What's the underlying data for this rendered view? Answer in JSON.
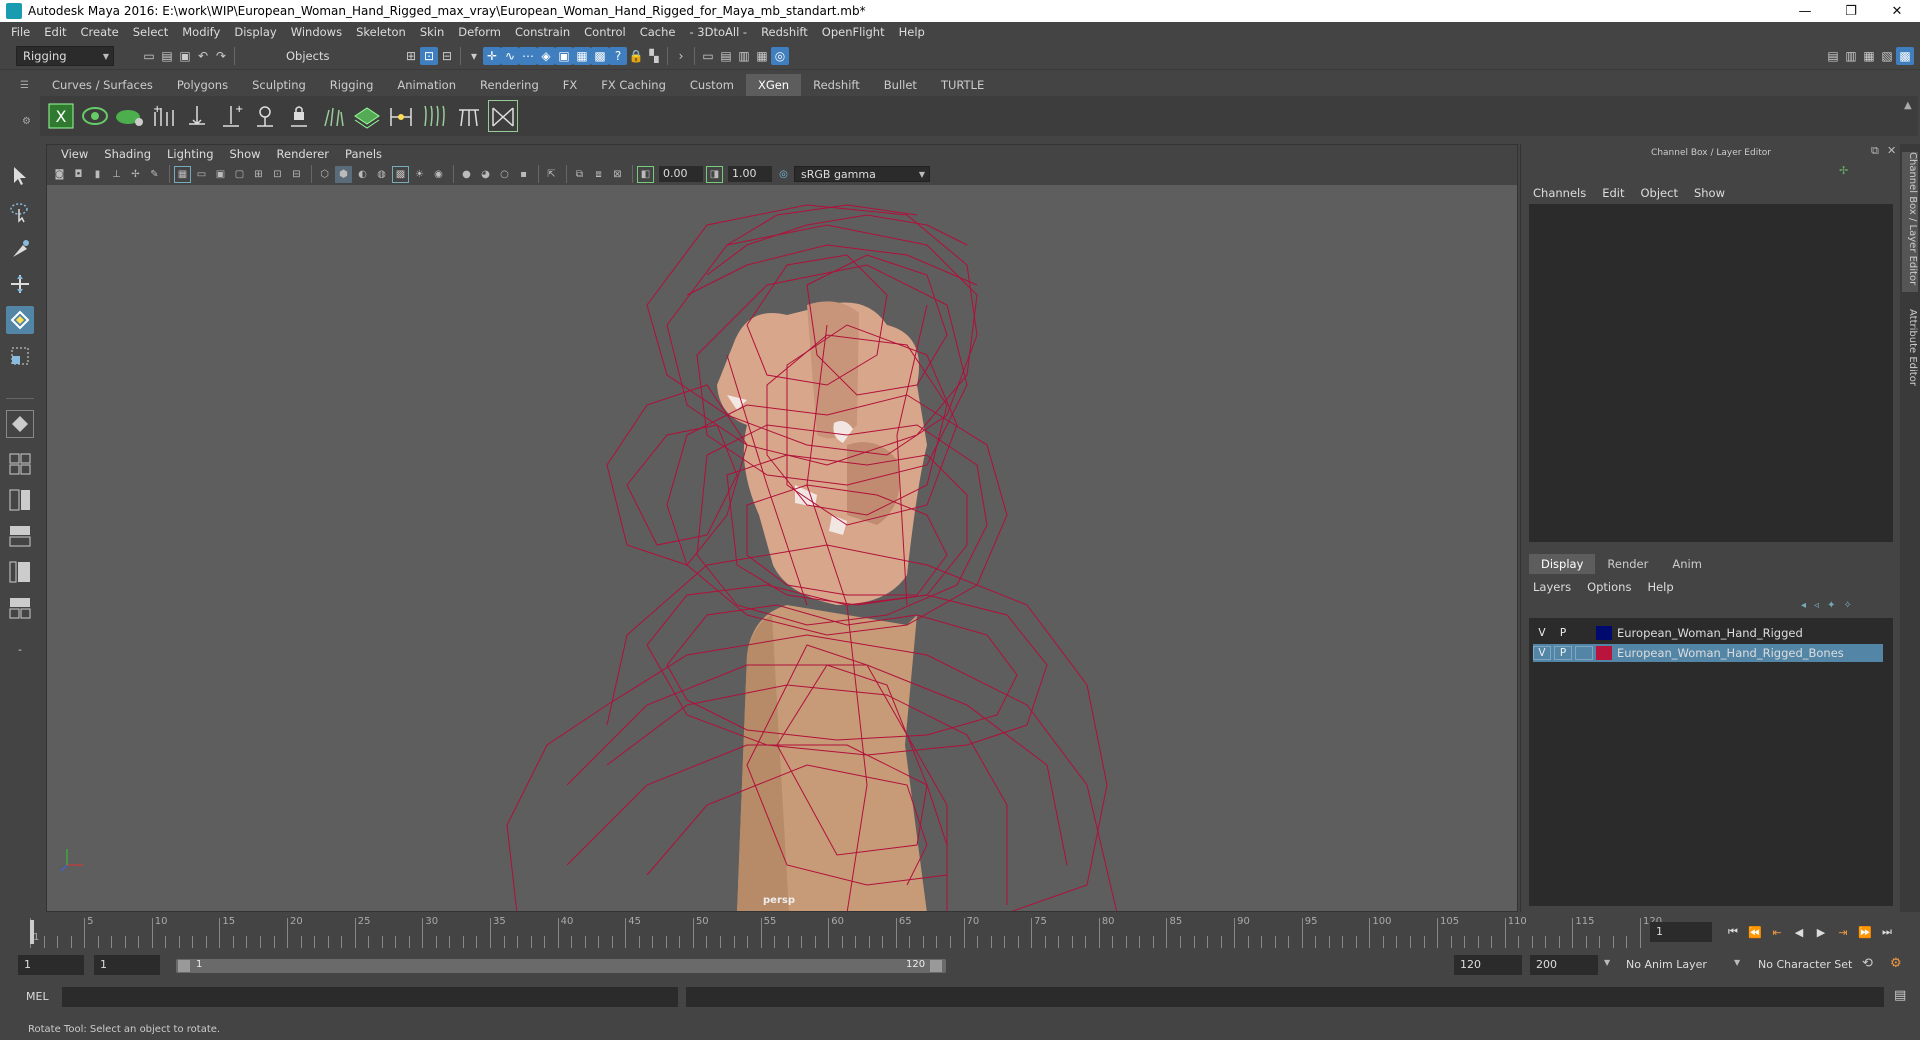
{
  "window": {
    "title": "Autodesk Maya 2016: E:\\work\\WIP\\European_Woman_Hand_Rigged_max_vray\\European_Woman_Hand_Rigged_for_Maya_mb_standart.mb*",
    "minimize": "—",
    "restore": "❐",
    "close": "✕"
  },
  "menubar": [
    "File",
    "Edit",
    "Create",
    "Select",
    "Modify",
    "Display",
    "Windows",
    "Skeleton",
    "Skin",
    "Deform",
    "Constrain",
    "Control",
    "Cache",
    "- 3DtoAll -",
    "Redshift",
    "OpenFlight",
    "Help"
  ],
  "statusline": {
    "mode": "Rigging",
    "selection_mode": "Objects"
  },
  "shelf_tabs": [
    "Curves / Surfaces",
    "Polygons",
    "Sculpting",
    "Rigging",
    "Animation",
    "Rendering",
    "FX",
    "FX Caching",
    "Custom",
    "XGen",
    "Redshift",
    "Bullet",
    "TURTLE"
  ],
  "shelf_active": "XGen",
  "viewport": {
    "menu": [
      "View",
      "Shading",
      "Lighting",
      "Show",
      "Renderer",
      "Panels"
    ],
    "exposure": "0.00",
    "gamma": "1.00",
    "color_space": "sRGB gamma",
    "camera": "persp"
  },
  "right_panel": {
    "header": "Channel Box / Layer Editor",
    "menu": [
      "Channels",
      "Edit",
      "Object",
      "Show"
    ],
    "layer_tabs": [
      "Display",
      "Render",
      "Anim"
    ],
    "layer_active": "Display",
    "layer_menu": [
      "Layers",
      "Options",
      "Help"
    ],
    "layers": [
      {
        "v": "V",
        "p": "P",
        "name": "European_Woman_Hand_Rigged",
        "color": "#000a6e",
        "selected": false
      },
      {
        "v": "V",
        "p": "P",
        "name": "European_Woman_Hand_Rigged_Bones",
        "color": "#b8143c",
        "selected": true
      }
    ],
    "side_tabs": [
      "Channel Box / Layer Editor",
      "Attribute Editor"
    ]
  },
  "timeline": {
    "ticks": [
      1,
      5,
      10,
      15,
      20,
      25,
      30,
      35,
      40,
      45,
      50,
      55,
      60,
      65,
      70,
      75,
      80,
      85,
      90,
      95,
      100,
      105,
      110,
      115,
      120
    ],
    "current_frame": "1",
    "start": "1",
    "playback_start": "1",
    "range_start": "1",
    "range_end": "120",
    "playback_end": "120",
    "end": "200",
    "anim_layer": "No Anim Layer",
    "character_set": "No Character Set"
  },
  "command_line": {
    "label": "MEL"
  },
  "help_line": "Rotate Tool: Select an object to rotate."
}
